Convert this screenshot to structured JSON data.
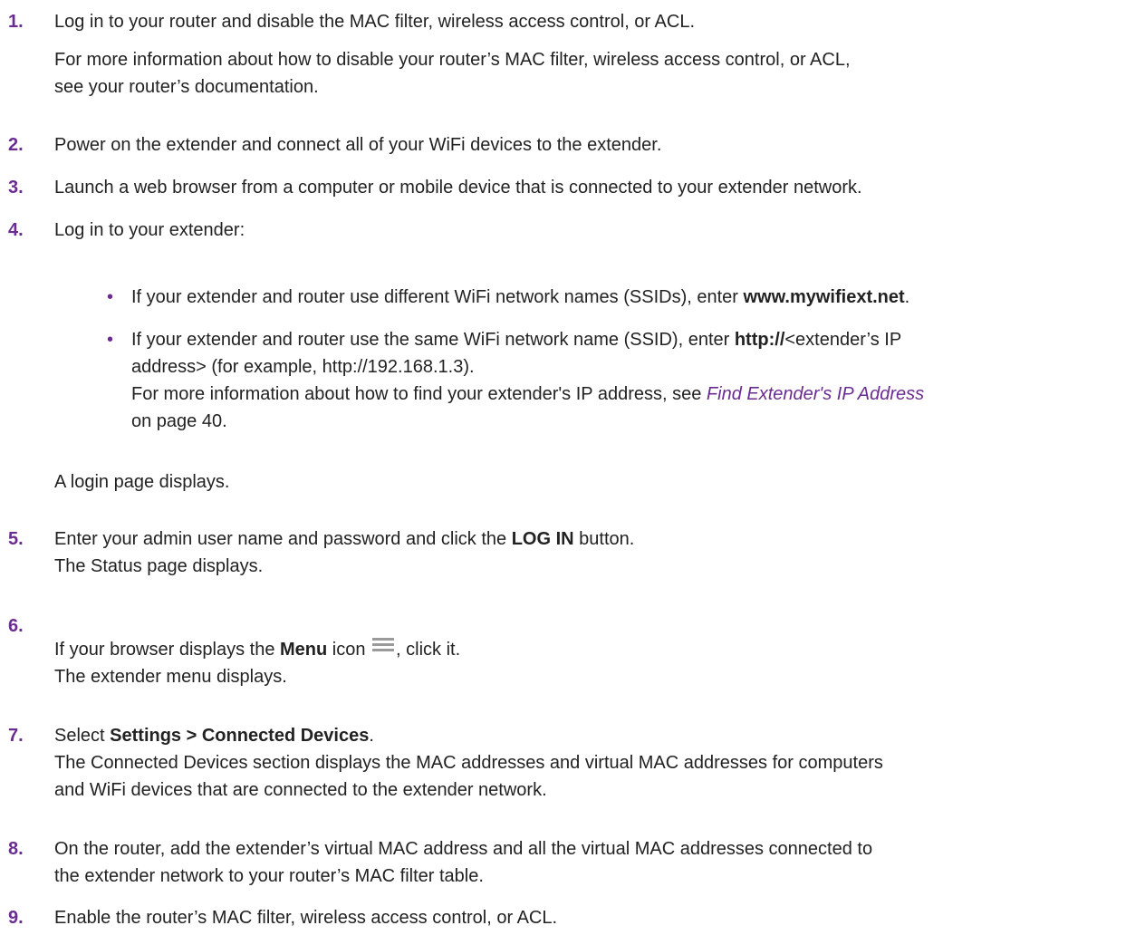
{
  "colors": {
    "accent": "#6b2c91",
    "text": "#222222",
    "icon": "#9a9a9a"
  },
  "steps": [
    {
      "num": "1.",
      "text": "Log in to your router and disable the MAC filter, wireless access control, or ACL.",
      "note_1": "For more information about how to disable your router’s MAC filter, wireless access control, or ACL,",
      "note_2": "see your router’s documentation."
    },
    {
      "num": "2.",
      "text": "Power on the extender and connect all of your WiFi devices to the extender."
    },
    {
      "num": "3.",
      "text": "Launch a web browser from a computer or mobile device that is connected to your extender network."
    },
    {
      "num": "4.",
      "text": "Log in to your extender:"
    },
    {
      "num": "5.",
      "text_a": "Enter your admin user name and password and click the ",
      "bold": "LOG IN",
      "text_b": " button.",
      "result": "The Status page displays."
    },
    {
      "num": "6.",
      "text_a": "If your browser displays the ",
      "bold": "Menu",
      "text_b": " icon ",
      "text_c": ", click it.",
      "result": "The extender menu displays."
    },
    {
      "num": "7.",
      "text_a": "Select ",
      "bold": "Settings > Connected Devices",
      "text_b": ".",
      "result_1": "The Connected Devices section displays the MAC addresses and virtual MAC addresses for computers",
      "result_2": "and WiFi devices that are connected to the extender network."
    },
    {
      "num": "8.",
      "line_1": "On the router, add the extender’s virtual MAC address and all the virtual MAC addresses connected to",
      "line_2": "the extender network to your router’s MAC filter table."
    },
    {
      "num": "9.",
      "text": "Enable the router’s MAC filter, wireless access control, or ACL."
    }
  ],
  "bullets": [
    {
      "symbol": "•",
      "text_a": "If your extender and router use different WiFi network names (SSIDs), enter ",
      "bold": "www.mywifiext.net",
      "text_b": "."
    },
    {
      "symbol": "•",
      "line1_a": "If your extender and router use the same WiFi network name (SSID), enter ",
      "line1_bold": "http://",
      "line1_b": "<extender’s IP",
      "line2": "address> (for example, http://192.168.1.3).",
      "line3_a": "For more information about how to find your extender's IP address, see ",
      "link": "Find Extender's IP Address",
      "line4": "on page 40."
    }
  ],
  "login_note": "A login page displays.",
  "icons": {
    "menu": "hamburger-menu-icon"
  }
}
